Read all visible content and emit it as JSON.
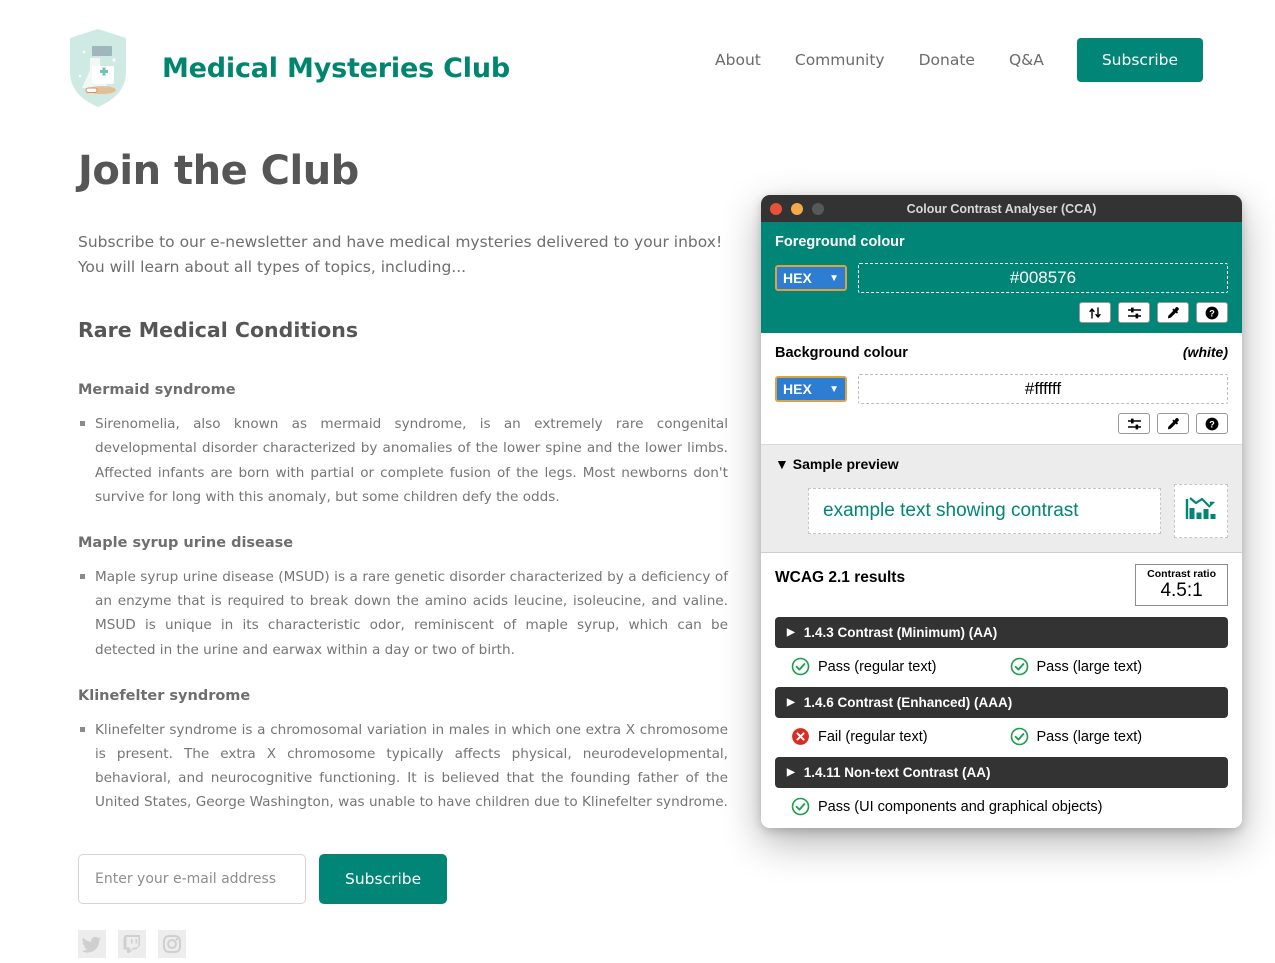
{
  "site": {
    "brand_name": "Medical Mysteries Club",
    "logo_icon": "shield-medical-badge-icon",
    "nav": [
      {
        "label": "About",
        "name": "nav-link-about"
      },
      {
        "label": "Community",
        "name": "nav-link-community"
      },
      {
        "label": "Donate",
        "name": "nav-link-donate"
      },
      {
        "label": "Q&A",
        "name": "nav-link-qa"
      }
    ],
    "cta_label": "Subscribe",
    "accent_color": "#008576"
  },
  "main": {
    "page_title": "Join the Club",
    "intro": "Subscribe to our e-newsletter and have medical mysteries delivered to your inbox! You will learn about all types of topics, including...",
    "section_title": "Rare Medical Conditions",
    "entries": [
      {
        "title": "Mermaid syndrome",
        "body": "Sirenomelia, also known as mermaid syndrome, is an extremely rare congenital developmental disorder characterized by anomalies of the lower spine and the lower limbs. Affected infants are born with partial or complete fusion of the legs. Most newborns don't survive for long with this anomaly, but some children defy the odds."
      },
      {
        "title": "Maple syrup urine disease",
        "body": "Maple syrup urine disease (MSUD) is a rare genetic disorder characterized by a deficiency of an enzyme that is required to break down the amino acids leucine, isoleucine, and valine. MSUD is unique in its characteristic odor, reminiscent of maple syrup, which can be detected in the urine and earwax within a day or two of birth."
      },
      {
        "title": "Klinefelter syndrome",
        "body": "Klinefelter syndrome is a chromosomal variation in males in which one extra X chromosome is present. The extra X chromosome typically affects physical, neurodevelopmental, behavioral, and neurocognitive functioning. It is believed that the founding father of the United States, George Washington, was unable to have children due to Klinefelter syndrome."
      }
    ],
    "email_placeholder": "Enter your e-mail address",
    "email_value": "",
    "subscribe_label": "Subscribe",
    "socials": [
      {
        "name": "twitter-icon",
        "label": "Twitter"
      },
      {
        "name": "twitch-icon",
        "label": "Twitch"
      },
      {
        "name": "instagram-icon",
        "label": "Instagram"
      }
    ]
  },
  "cca": {
    "window_title": "Colour Contrast Analyser (CCA)",
    "foreground": {
      "label": "Foreground colour",
      "format": "HEX",
      "value": "#008576",
      "icons": [
        {
          "name": "swap-colours-icon"
        },
        {
          "name": "sliders-icon"
        },
        {
          "name": "eyedropper-icon"
        },
        {
          "name": "help-icon"
        }
      ]
    },
    "background": {
      "label": "Background colour",
      "note": "(white)",
      "format": "HEX",
      "value": "#ffffff",
      "icons": [
        {
          "name": "sliders-icon"
        },
        {
          "name": "eyedropper-icon"
        },
        {
          "name": "help-icon"
        }
      ]
    },
    "preview": {
      "label": "Sample preview",
      "sample_text": "example text showing contrast",
      "graphic_icon": "declining-bar-chart-icon"
    },
    "results": {
      "title": "WCAG 2.1 results",
      "ratio_label": "Contrast ratio",
      "ratio_value": "4.5:1",
      "criteria": [
        {
          "name": "criterion-1-4-3",
          "label": "1.4.3 Contrast (Minimum) (AA)",
          "results": [
            {
              "status": "pass",
              "text": "Pass (regular text)"
            },
            {
              "status": "pass",
              "text": "Pass (large text)"
            }
          ]
        },
        {
          "name": "criterion-1-4-6",
          "label": "1.4.6 Contrast (Enhanced) (AAA)",
          "results": [
            {
              "status": "fail",
              "text": "Fail (regular text)"
            },
            {
              "status": "pass",
              "text": "Pass (large text)"
            }
          ]
        },
        {
          "name": "criterion-1-4-11",
          "label": "1.4.11 Non-text Contrast (AA)",
          "results": [
            {
              "status": "pass",
              "text": "Pass (UI components and graphical objects)"
            }
          ]
        }
      ]
    }
  }
}
